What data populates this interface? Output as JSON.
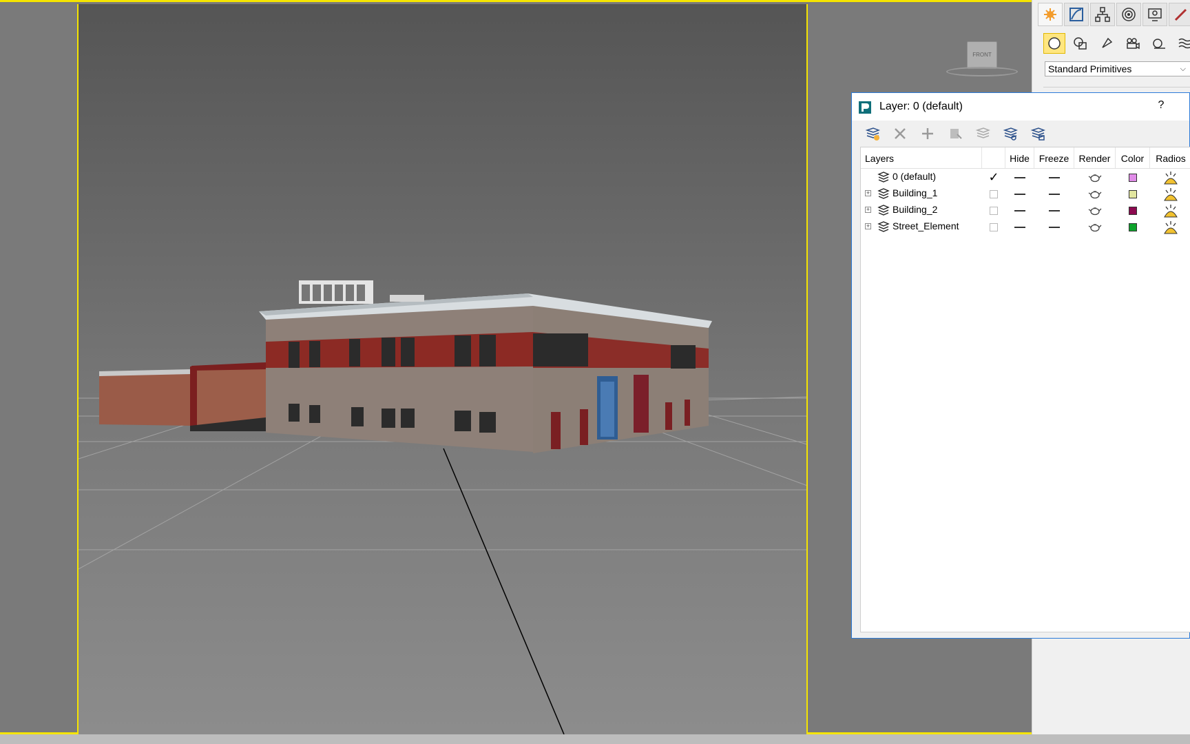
{
  "viewport": {
    "viewcube_label": "FRONT"
  },
  "command_panel": {
    "tabs": [
      "create-icon",
      "modify-icon",
      "hierarchy-icon",
      "motion-icon",
      "display-icon",
      "utilities-icon"
    ],
    "subtabs": [
      "geometry-icon",
      "shapes-icon",
      "lights-icon",
      "cameras-icon",
      "helpers-icon",
      "spacewarps-icon",
      "systems-icon"
    ],
    "dropdown_value": "Standard Primitives"
  },
  "layer_dialog": {
    "title": "Layer: 0 (default)",
    "help": "?",
    "toolbar": [
      "create-layer-icon",
      "delete-layer-icon",
      "add-to-layer-icon",
      "select-objects-icon",
      "select-layer-icon",
      "layer-properties-icon",
      "hide-freeze-icon"
    ],
    "columns": {
      "layers": "Layers",
      "hide": "Hide",
      "freeze": "Freeze",
      "render": "Render",
      "color": "Color",
      "radiosity": "Radios"
    },
    "rows": [
      {
        "name": "0 (default)",
        "current": true,
        "expandable": false,
        "color": "#e08ce8"
      },
      {
        "name": "Building_1",
        "current": false,
        "expandable": true,
        "color": "#e2e6a0"
      },
      {
        "name": "Building_2",
        "current": false,
        "expandable": true,
        "color": "#8c0a50"
      },
      {
        "name": "Street_Element",
        "current": false,
        "expandable": true,
        "color": "#0ea32c"
      }
    ],
    "expand_glyph": "+",
    "check_glyph": "✓"
  },
  "colors": {
    "viewport_border": "#f5e400",
    "dialog_accent": "#2b7ad9"
  }
}
